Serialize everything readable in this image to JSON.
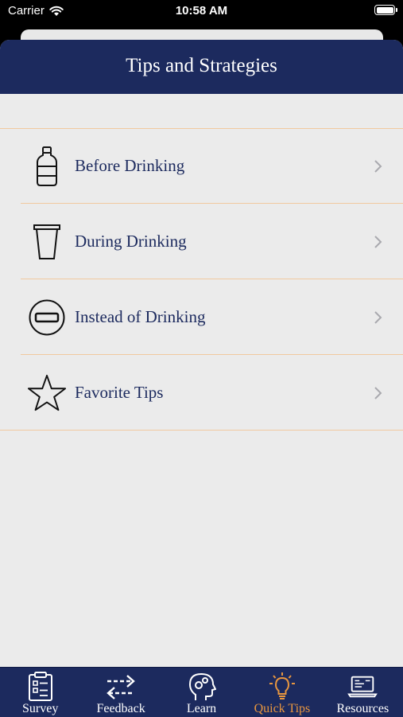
{
  "status_bar": {
    "carrier": "Carrier",
    "time": "10:58 AM"
  },
  "nav": {
    "title": "Tips and Strategies"
  },
  "rows": [
    {
      "label": "Before Drinking",
      "icon": "water-bottle-icon"
    },
    {
      "label": "During Drinking",
      "icon": "cup-icon"
    },
    {
      "label": "Instead of Drinking",
      "icon": "minus-circle-icon"
    },
    {
      "label": "Favorite Tips",
      "icon": "star-outline-icon"
    }
  ],
  "tabs": [
    {
      "label": "Survey",
      "icon": "clipboard-icon",
      "active": false
    },
    {
      "label": "Feedback",
      "icon": "arrows-exchange-icon",
      "active": false
    },
    {
      "label": "Learn",
      "icon": "head-gears-icon",
      "active": false
    },
    {
      "label": "Quick Tips",
      "icon": "lightbulb-icon",
      "active": true
    },
    {
      "label": "Resources",
      "icon": "laptop-icon",
      "active": false
    }
  ],
  "colors": {
    "navy": "#1c2a5e",
    "accent": "#e8963f",
    "divider": "#f1c99f",
    "background": "#ebebeb"
  }
}
